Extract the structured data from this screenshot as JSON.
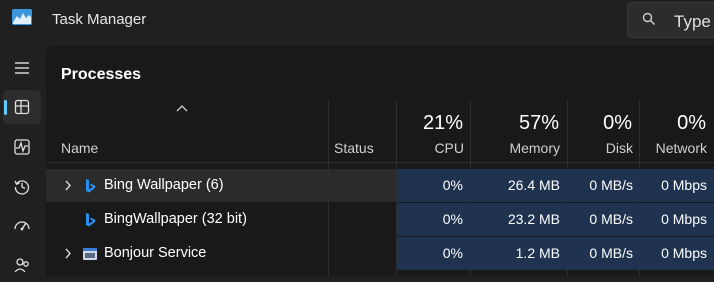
{
  "window": {
    "title": "Task Manager"
  },
  "search": {
    "placeholder": "Type"
  },
  "sidebar": {
    "items": [
      {
        "icon": "hamburger-menu-icon"
      },
      {
        "icon": "processes-icon",
        "active": true
      },
      {
        "icon": "performance-icon"
      },
      {
        "icon": "app-history-icon"
      },
      {
        "icon": "startup-apps-icon"
      },
      {
        "icon": "users-icon"
      }
    ],
    "accent": "#60cdff"
  },
  "page": {
    "title": "Processes"
  },
  "columns": {
    "name": "Name",
    "status": "Status",
    "cpu": {
      "pct": "21%",
      "label": "CPU"
    },
    "memory": {
      "pct": "57%",
      "label": "Memory"
    },
    "disk": {
      "pct": "0%",
      "label": "Disk"
    },
    "network": {
      "pct": "0%",
      "label": "Network"
    }
  },
  "rows": [
    {
      "expandable": true,
      "selected": true,
      "icon": "bing-icon",
      "name": "Bing Wallpaper (6)",
      "status": "",
      "cpu": "0%",
      "memory": "26.4 MB",
      "disk": "0 MB/s",
      "network": "0 Mbps"
    },
    {
      "expandable": false,
      "selected": false,
      "icon": "bing-icon",
      "name": "BingWallpaper (32 bit)",
      "status": "",
      "cpu": "0%",
      "memory": "23.2 MB",
      "disk": "0 MB/s",
      "network": "0 Mbps"
    },
    {
      "expandable": true,
      "selected": false,
      "icon": "service-window-icon",
      "name": "Bonjour Service",
      "status": "",
      "cpu": "0%",
      "memory": "1.2 MB",
      "disk": "0 MB/s",
      "network": "0 Mbps"
    }
  ],
  "colors": {
    "heatmap": "#1f3350",
    "background": "#191919"
  }
}
